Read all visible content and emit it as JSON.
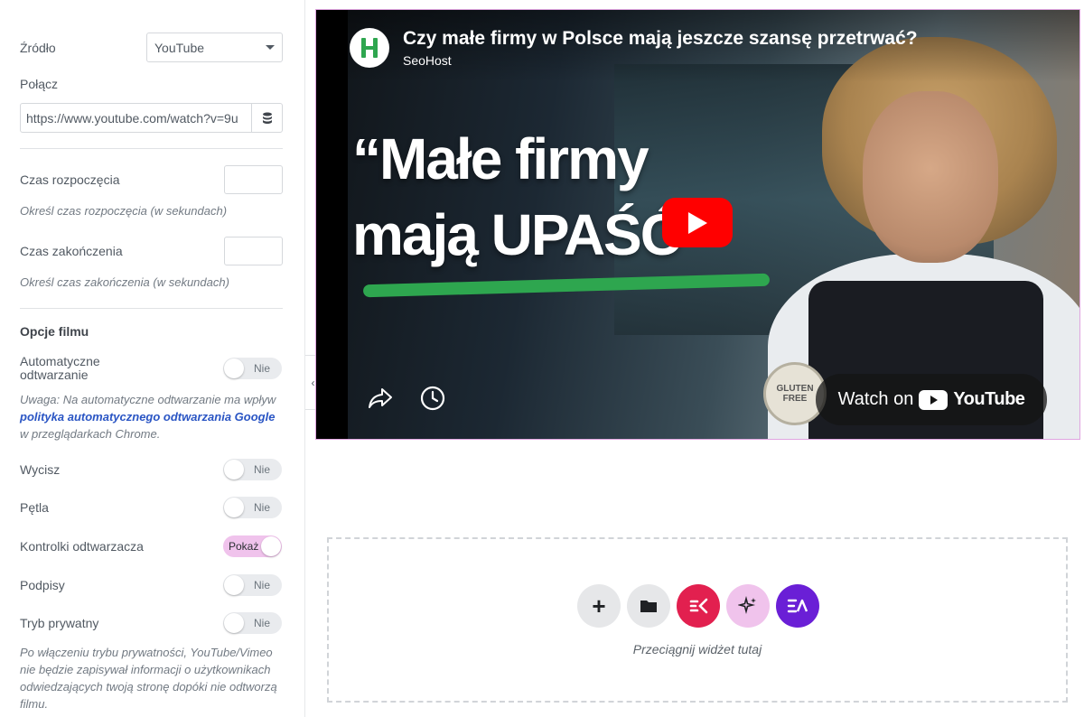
{
  "panel": {
    "source_label": "Źródło",
    "source_value": "YouTube",
    "link_label": "Połącz",
    "link_value": "https://www.youtube.com/watch?v=9u",
    "start_label": "Czas rozpoczęcia",
    "start_hint": "Określ czas rozpoczęcia (w sekundach)",
    "end_label": "Czas zakończenia",
    "end_hint": "Określ czas zakończenia (w sekundach)",
    "options_heading": "Opcje filmu",
    "autoplay_label": "Automatyczne odtwarzanie",
    "autoplay_toggle": "Nie",
    "autoplay_note_pre": "Uwaga: Na automatyczne odtwarzanie ma wpływ",
    "autoplay_note_link": "polityka automatycznego odtwarzania Google",
    "autoplay_note_post": "w przeglądarkach Chrome.",
    "mute_label": "Wycisz",
    "mute_toggle": "Nie",
    "loop_label": "Pętla",
    "loop_toggle": "Nie",
    "controls_label": "Kontrolki odtwarzacza",
    "controls_toggle": "Pokaż",
    "captions_label": "Podpisy",
    "captions_toggle": "Nie",
    "privacy_label": "Tryb prywatny",
    "privacy_toggle": "Nie",
    "privacy_note": "Po włączeniu trybu prywatności, YouTube/Vimeo nie będzie zapisywał informacji o użytkownikach odwiedzających twoją stronę dopóki nie odtworzą filmu."
  },
  "video": {
    "title": "Czy małe firmy w Polsce mają jeszcze szansę przetrwać?",
    "channel": "SeoHost",
    "overlay_line1": "“Małe firmy",
    "overlay_line2": "mają UPAŚĆ”",
    "badge_text": "GLUTEN FREE",
    "watch_on": "Watch on",
    "youtube_word": "YouTube"
  },
  "dropzone": {
    "text": "Przeciągnij widżet tutaj",
    "colors": {
      "add": "#e6e7e9",
      "folder": "#e6e7e9",
      "ek": "#e2204f",
      "ai": "#f0c3ec",
      "ea": "#6a1fd6"
    }
  },
  "colors": {
    "accent_pink": "#f0c3ec",
    "link": "#2a55c4",
    "youtube_red": "#ff0000",
    "green_stroke": "#2ea64f"
  }
}
